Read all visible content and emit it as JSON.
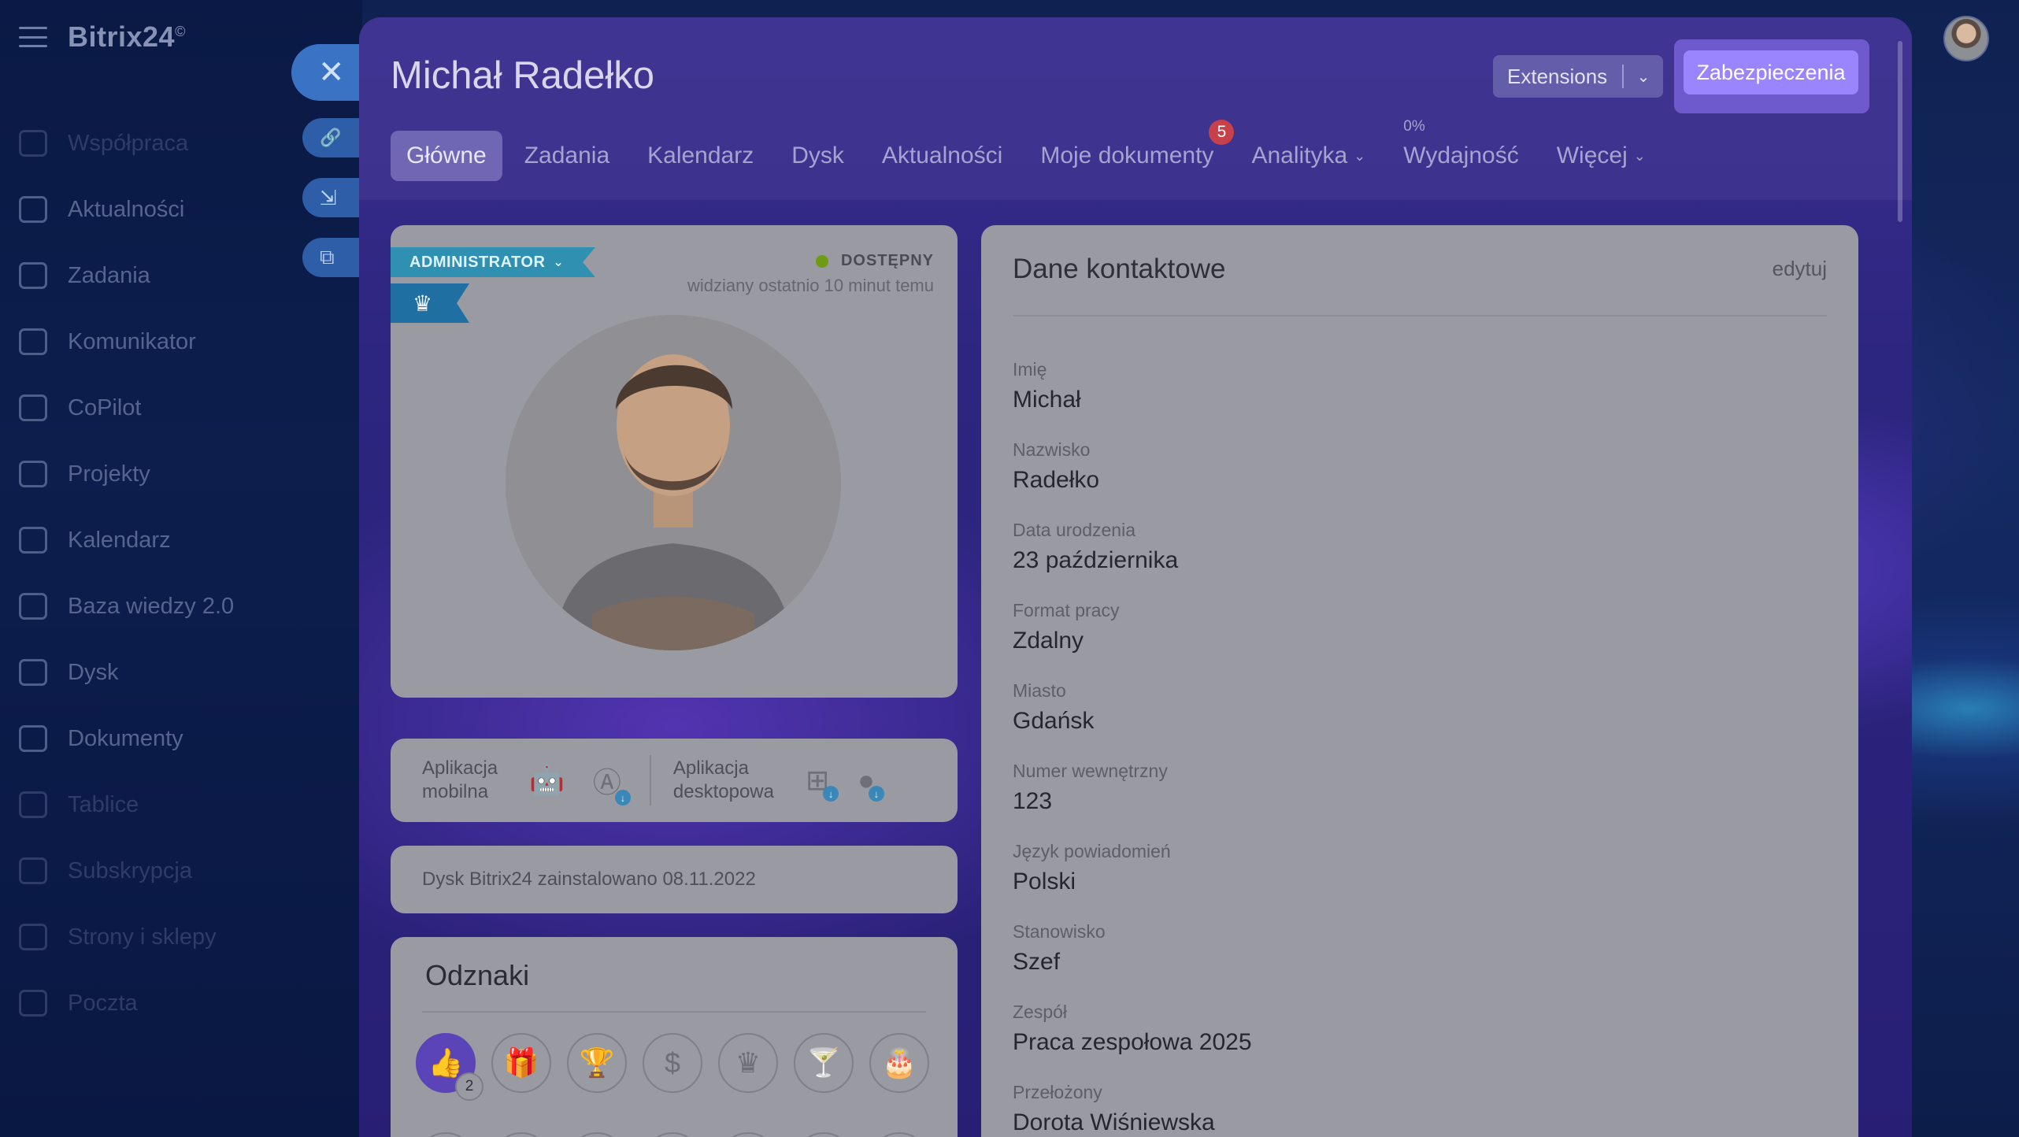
{
  "app": {
    "brand": "Bitrix24",
    "brand_mark": "©"
  },
  "sidebar": {
    "items": [
      {
        "label": "Współpraca",
        "icon": "collab-icon",
        "dim": true
      },
      {
        "label": "Aktualności",
        "icon": "news-icon",
        "dim": false
      },
      {
        "label": "Zadania",
        "icon": "tasks-icon",
        "dim": false
      },
      {
        "label": "Komunikator",
        "icon": "chat-icon",
        "dim": false
      },
      {
        "label": "CoPilot",
        "icon": "copilot-icon",
        "dim": false
      },
      {
        "label": "Projekty",
        "icon": "projects-icon",
        "dim": false
      },
      {
        "label": "Kalendarz",
        "icon": "calendar-icon",
        "dim": false
      },
      {
        "label": "Baza wiedzy 2.0",
        "icon": "knowledge-icon",
        "dim": false
      },
      {
        "label": "Dysk",
        "icon": "drive-icon",
        "dim": false
      },
      {
        "label": "Dokumenty",
        "icon": "documents-icon",
        "dim": false
      },
      {
        "label": "Tablice",
        "icon": "boards-icon",
        "dim": true
      },
      {
        "label": "Subskrypcja",
        "icon": "subscription-icon",
        "dim": true
      },
      {
        "label": "Strony i sklepy",
        "icon": "shop-icon",
        "dim": true
      },
      {
        "label": "Poczta",
        "icon": "mail-icon",
        "dim": true
      }
    ]
  },
  "side_actions": {
    "close": "✕",
    "link": "🔗",
    "download": "⇲",
    "open": "⧉"
  },
  "profile": {
    "name": "Michał Radełko",
    "extensions_label": "Extensions",
    "security_label": "Zabezpieczenia",
    "tabs": [
      {
        "label": "Główne",
        "active": true
      },
      {
        "label": "Zadania"
      },
      {
        "label": "Kalendarz"
      },
      {
        "label": "Dysk"
      },
      {
        "label": "Aktualności"
      },
      {
        "label": "Moje dokumenty",
        "badge": "5"
      },
      {
        "label": "Analityka",
        "dropdown": true
      },
      {
        "label": "Wydajność",
        "top": "0%"
      },
      {
        "label": "Więcej",
        "dropdown": true
      }
    ],
    "role": "ADMINISTRATOR",
    "status": "DOSTĘPNY",
    "last_seen": "widziany ostatnio 10 minut temu"
  },
  "apps": {
    "mobile_line1": "Aplikacja",
    "mobile_line2": "mobilna",
    "desktop_line1": "Aplikacja",
    "desktop_line2": "desktopowa"
  },
  "disk_info": "Dysk Bitrix24 zainstalowano 08.11.2022",
  "badges": {
    "title": "Odznaki",
    "like_count": "2"
  },
  "contact": {
    "title": "Dane kontaktowe",
    "edit": "edytuj",
    "fields": [
      {
        "label": "Imię",
        "value": "Michał"
      },
      {
        "label": "Nazwisko",
        "value": "Radełko"
      },
      {
        "label": "Data urodzenia",
        "value": "23 października"
      },
      {
        "label": "Format pracy",
        "value": "Zdalny"
      },
      {
        "label": "Miasto",
        "value": "Gdańsk"
      },
      {
        "label": "Numer wewnętrzny",
        "value": "123"
      },
      {
        "label": "Język powiadomień",
        "value": "Polski"
      },
      {
        "label": "Stanowisko",
        "value": "Szef"
      },
      {
        "label": "Zespół",
        "value": "Praca zespołowa 2025"
      },
      {
        "label": "Przełożony",
        "value": "Dorota Wiśniewska"
      }
    ]
  },
  "colors": {
    "accent": "#9a85ff",
    "status_online": "#6d9b14",
    "admin_tag": "#2f90b2",
    "badge_red": "#c7414a"
  }
}
